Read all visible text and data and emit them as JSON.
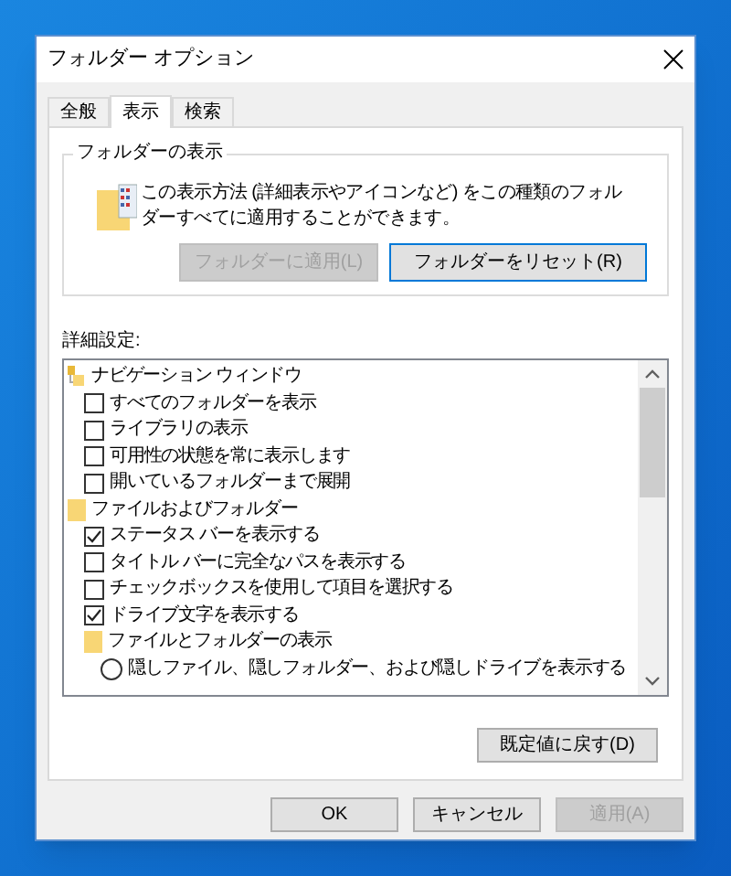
{
  "window": {
    "title": "フォルダー オプション"
  },
  "tabs": [
    {
      "label": "全般",
      "selected": false
    },
    {
      "label": "表示",
      "selected": true
    },
    {
      "label": "検索",
      "selected": false
    }
  ],
  "folder_views": {
    "legend": "フォルダーの表示",
    "description": "この表示方法 (詳細表示やアイコンなど) をこの種類のフォルダーすべてに適用することができます。",
    "buttons": [
      {
        "label": "フォルダーに適用(L)",
        "disabled": true,
        "default": false
      },
      {
        "label": "フォルダーをリセット(R)",
        "disabled": false,
        "default": true
      }
    ]
  },
  "advanced": {
    "label": "詳細設定:",
    "items": [
      {
        "kind": "pane-group",
        "label": "ナビゲーション ウィンドウ",
        "children": [
          {
            "kind": "checkbox",
            "label": "すべてのフォルダーを表示",
            "checked": false
          },
          {
            "kind": "checkbox",
            "label": "ライブラリの表示",
            "checked": false
          },
          {
            "kind": "checkbox",
            "label": "可用性の状態を常に表示します",
            "checked": false
          },
          {
            "kind": "checkbox",
            "label": "開いているフォルダーまで展開",
            "checked": false
          }
        ]
      },
      {
        "kind": "folder-group",
        "label": "ファイルおよびフォルダー",
        "children": [
          {
            "kind": "checkbox",
            "label": "ステータス バーを表示する",
            "checked": true
          },
          {
            "kind": "checkbox",
            "label": "タイトル バーに完全なパスを表示する",
            "checked": false
          },
          {
            "kind": "checkbox",
            "label": "チェックボックスを使用して項目を選択する",
            "checked": false
          },
          {
            "kind": "checkbox",
            "label": "ドライブ文字を表示する",
            "checked": true
          },
          {
            "kind": "folder-group",
            "label": "ファイルとフォルダーの表示",
            "children": [
              {
                "kind": "radio",
                "label": "隠しファイル、隠しフォルダー、および隠しドライブを表示する",
                "selected": false
              }
            ]
          }
        ]
      }
    ],
    "restore_button": {
      "label": "既定値に戻す(D)"
    }
  },
  "buttons": [
    {
      "label": "OK",
      "disabled": false
    },
    {
      "label": "キャンセル",
      "disabled": false
    },
    {
      "label": "適用(A)",
      "disabled": true
    }
  ]
}
